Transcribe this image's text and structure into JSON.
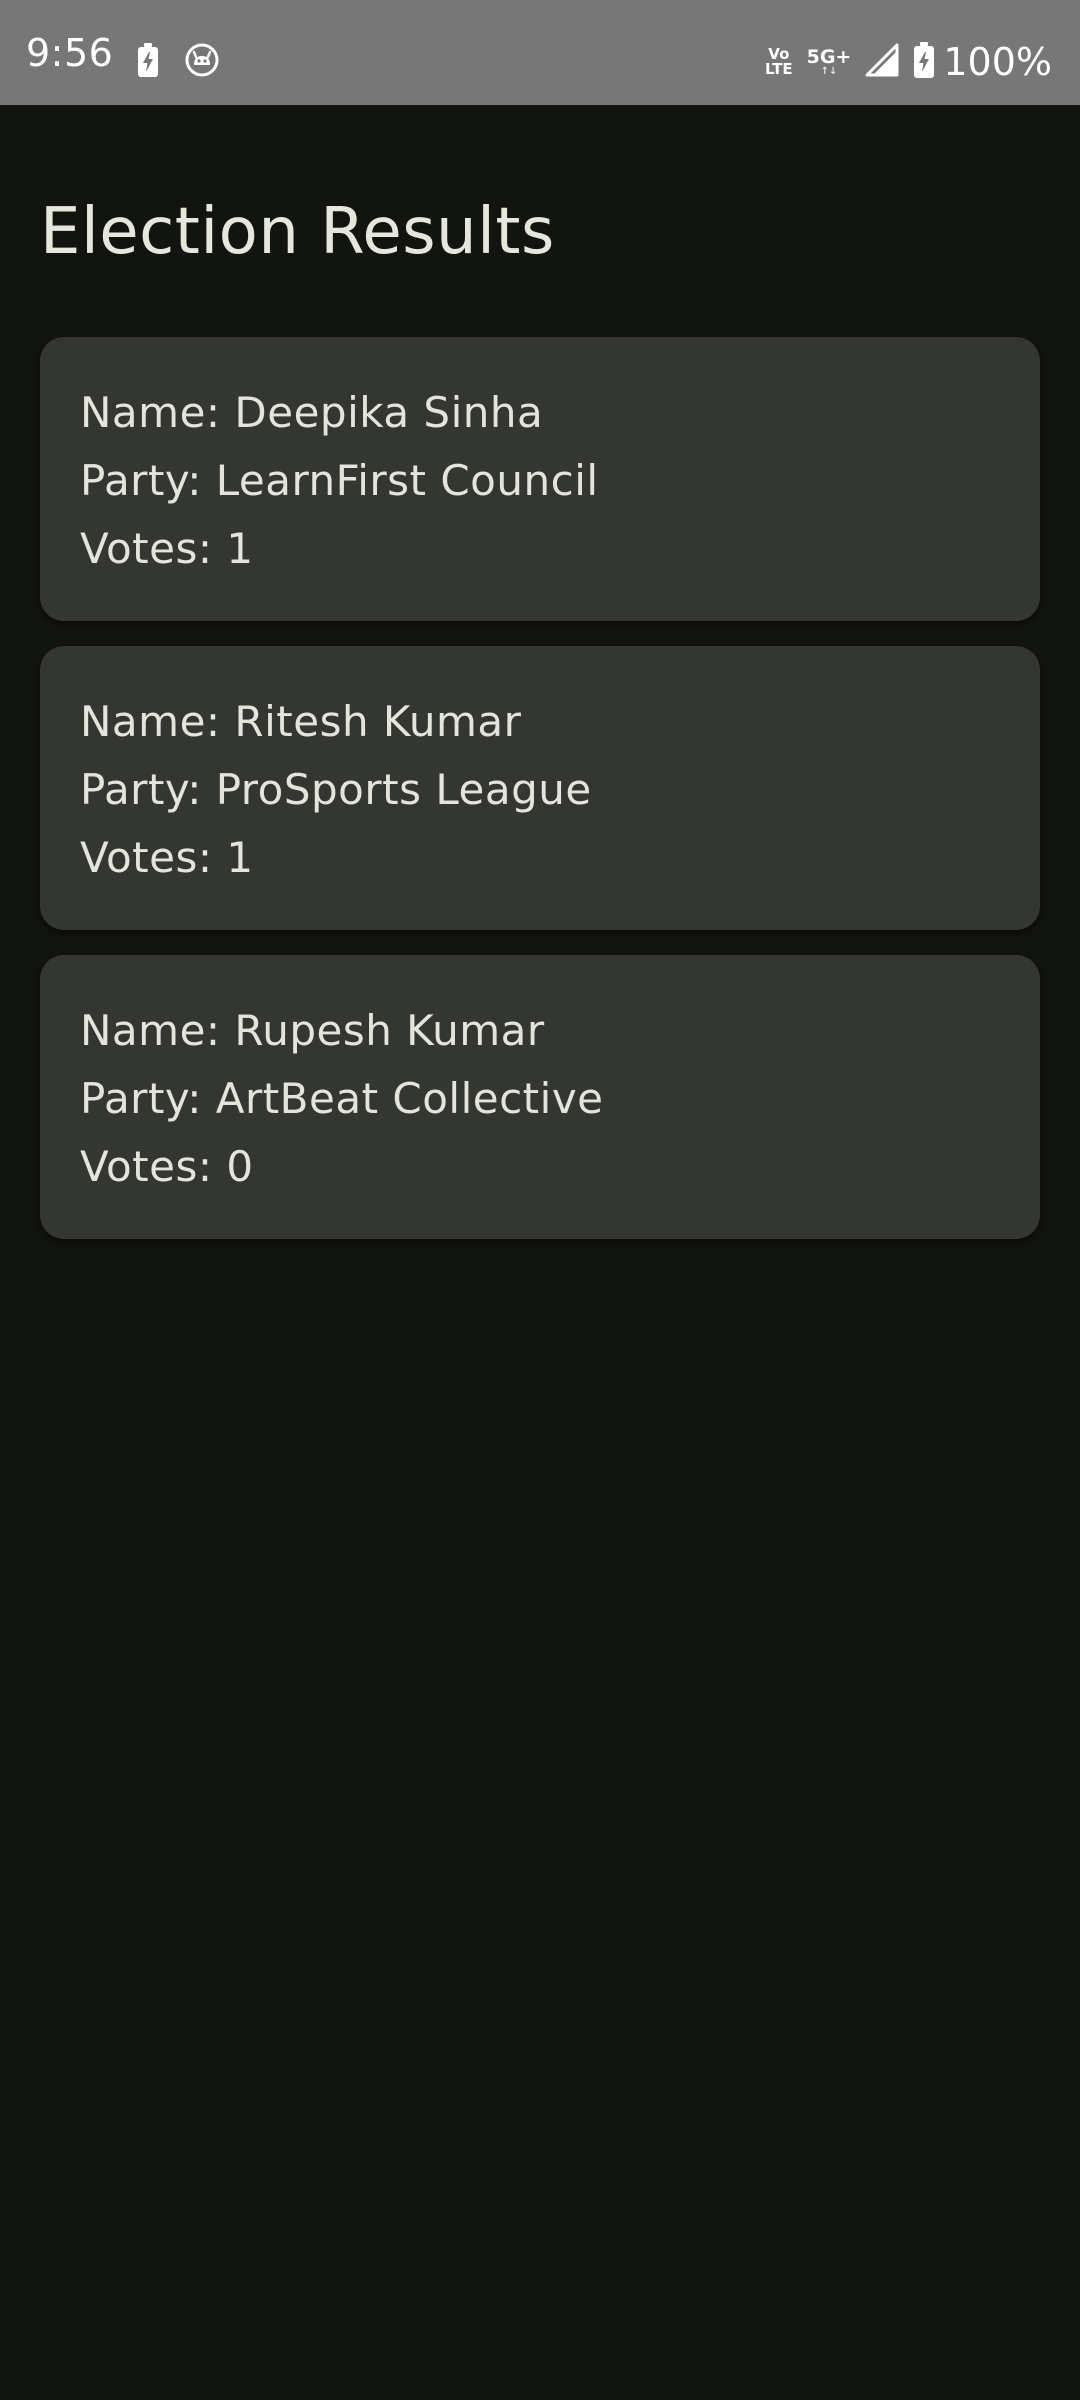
{
  "status_bar": {
    "time": "9:56",
    "volte_top": "Vo",
    "volte_bottom": "LTE",
    "network": "5G+",
    "network_arrows": "↑↓",
    "battery": "100%"
  },
  "page": {
    "title": "Election Results"
  },
  "candidates": [
    {
      "name": "Name: Deepika Sinha",
      "party": "Party: LearnFirst Council",
      "votes": "Votes: 1"
    },
    {
      "name": "Name: Ritesh Kumar",
      "party": "Party: ProSports League",
      "votes": "Votes: 1"
    },
    {
      "name": "Name: Rupesh Kumar",
      "party": "Party: ArtBeat Collective",
      "votes": "Votes: 0"
    }
  ],
  "icons": {
    "charging": "battery-charging-icon",
    "notification": "app-notification-icon",
    "signal": "signal-strength-icon",
    "battery": "battery-icon"
  },
  "colors": {
    "background": "#121410",
    "card": "#343631",
    "status_bar": "#777777",
    "text": "#e4e4dc"
  }
}
